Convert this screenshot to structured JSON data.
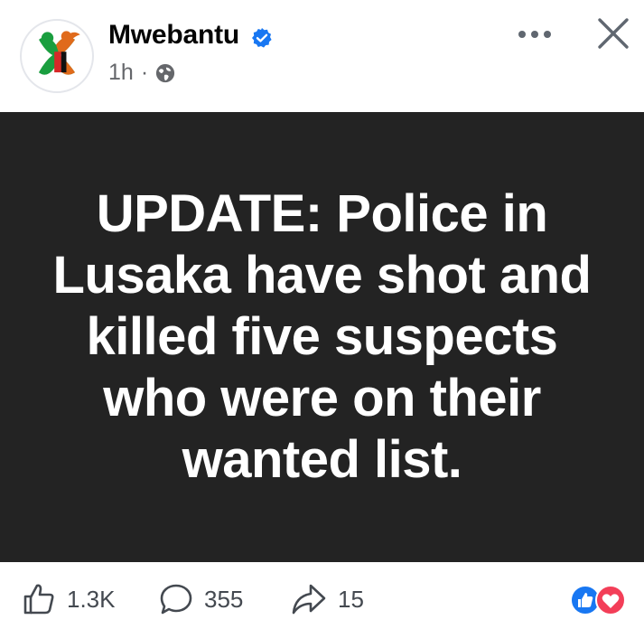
{
  "post": {
    "author": "Mwebantu",
    "time": "1h",
    "separator": "·",
    "image_text": "UPDATE: Police in Lusaka have shot and killed five suspects who were on their wanted list."
  },
  "engagement": {
    "likes": "1.3K",
    "comments": "355",
    "shares": "15"
  },
  "icons": {
    "avatar": "mwebantu-logo",
    "verified": "verified-badge-icon",
    "privacy": "globe-icon",
    "more": "more-dots-icon",
    "close": "close-icon",
    "like": "thumbs-up-icon",
    "comment": "comment-icon",
    "share": "share-icon",
    "reactions": [
      "like-reaction-icon",
      "love-reaction-icon"
    ]
  },
  "colors": {
    "verified_blue": "#1877f2",
    "image_background": "#232323",
    "love_red": "#f33e58",
    "secondary_text": "#65676b"
  }
}
